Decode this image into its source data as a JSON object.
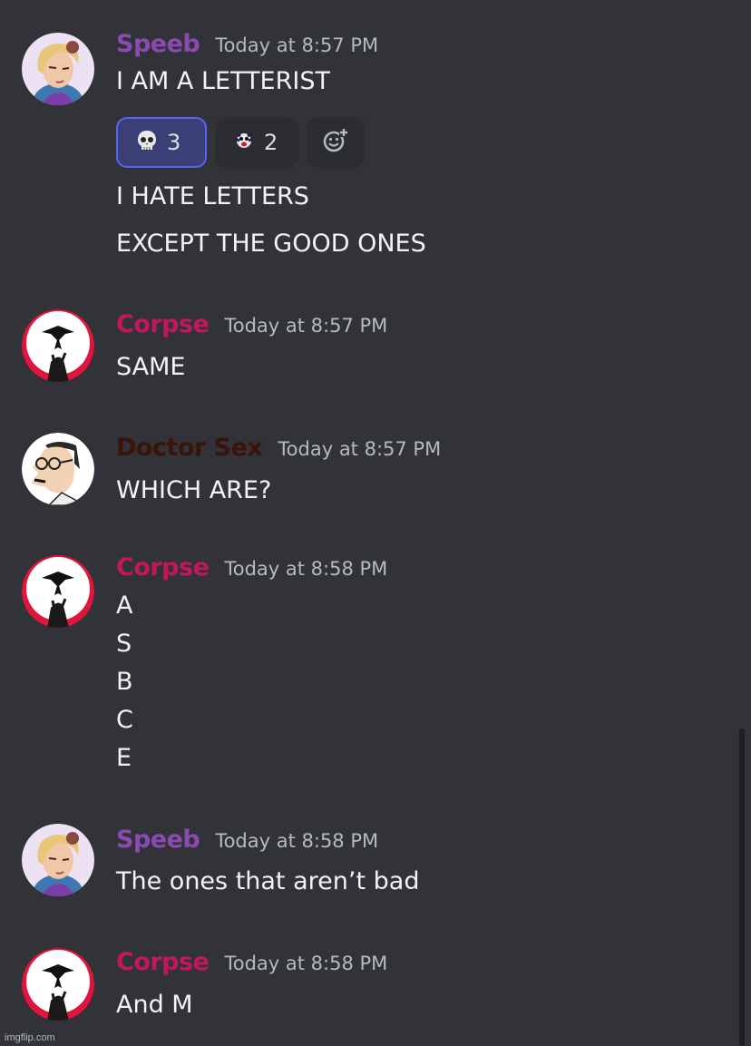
{
  "colors": {
    "background": "#313338",
    "speeb": "#8a4ab0",
    "corpse": "#c2185b",
    "doctor": "#3a1408",
    "timestamp": "#b5bac1"
  },
  "messages": [
    {
      "author": "Speeb",
      "timestamp": "Today at 8:57 PM",
      "avatar_icon": "speeb-avatar",
      "lines": [
        "I AM A LETTERIST"
      ],
      "reactions": [
        {
          "emoji": "skull-icon",
          "count": "3",
          "reacted": true
        },
        {
          "emoji": "custom-emoji-icon",
          "count": "2",
          "reacted": false
        },
        {
          "emoji": "add-reaction-icon",
          "count": "",
          "reacted": false
        }
      ],
      "followups": [
        "I HATE LETTERS",
        "EXCEPT THE GOOD ONES"
      ]
    },
    {
      "author": "Corpse",
      "timestamp": "Today at 8:57 PM",
      "avatar_icon": "corpse-avatar",
      "lines": [
        "SAME"
      ]
    },
    {
      "author": "Doctor Sex",
      "timestamp": "Today at 8:57 PM",
      "avatar_icon": "doctor-avatar",
      "lines": [
        "WHICH ARE?"
      ]
    },
    {
      "author": "Corpse",
      "timestamp": "Today at 8:58 PM",
      "avatar_icon": "corpse-avatar",
      "lines": [
        "A",
        "S",
        "B",
        "C",
        "E"
      ]
    },
    {
      "author": "Speeb",
      "timestamp": "Today at 8:58 PM",
      "avatar_icon": "speeb-avatar",
      "lines": [
        "The ones that aren’t bad"
      ]
    },
    {
      "author": "Corpse",
      "timestamp": "Today at 8:58 PM",
      "avatar_icon": "corpse-avatar",
      "lines": [
        "And M"
      ]
    }
  ],
  "watermark": "imgflip.com"
}
